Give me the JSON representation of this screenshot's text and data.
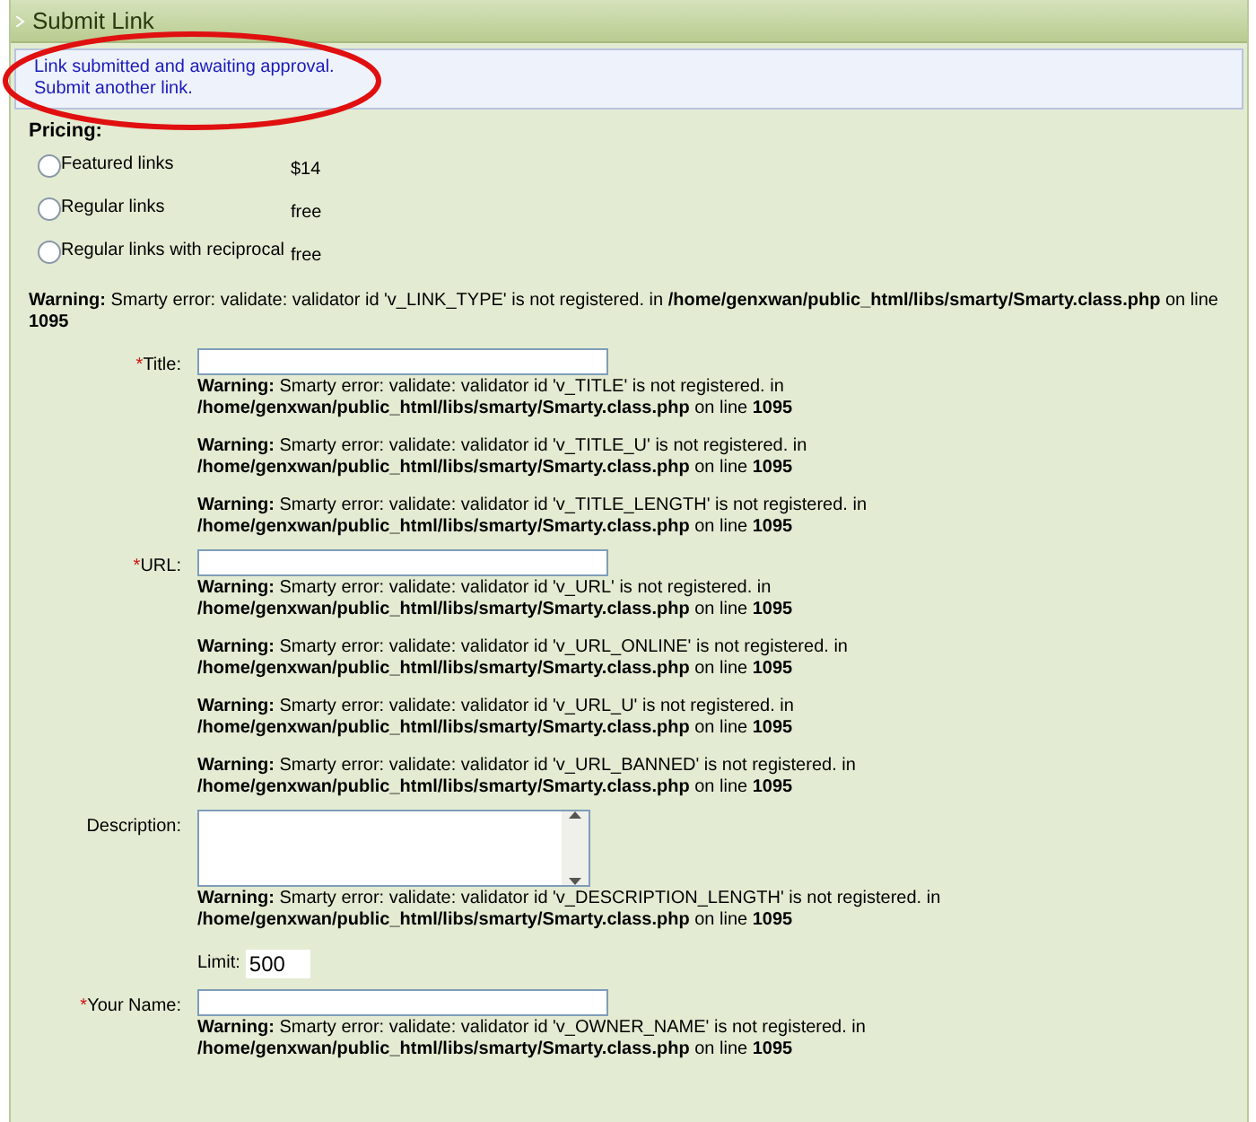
{
  "panel": {
    "title": "Submit Link"
  },
  "message": {
    "text": "Link submitted and awaiting approval.",
    "link": "Submit another link."
  },
  "pricing": {
    "label": "Pricing:",
    "options": [
      {
        "label": "Featured links",
        "price": "$14",
        "selected": false
      },
      {
        "label": "Regular links",
        "price": "free",
        "selected": false
      },
      {
        "label": "Regular links with reciprocal",
        "price": "free",
        "selected": false
      }
    ],
    "warning": "**Warning:** Smarty error: validate: validator id 'v_LINK_TYPE' is not registered. in **/home/genxwan/public_html/libs/smarty/Smarty.class.php** on line **1095**"
  },
  "fields": [
    {
      "kind": "text",
      "required_mark": "*",
      "label": "Title:",
      "warnings": [
        "**Warning:** Smarty error: validate: validator id 'v_TITLE' is not registered. in **/home/genxwan/public_html/libs/smarty/Smarty.class.php** on line **1095**",
        "**Warning:** Smarty error: validate: validator id 'v_TITLE_U' is not registered. in **/home/genxwan/public_html/libs/smarty/Smarty.class.php** on line **1095**",
        "**Warning:** Smarty error: validate: validator id 'v_TITLE_LENGTH' is not registered. in **/home/genxwan/public_html/libs/smarty/Smarty.class.php** on line **1095**"
      ]
    },
    {
      "kind": "text",
      "required_mark": "*",
      "label": "URL:",
      "warnings": [
        "**Warning:** Smarty error: validate: validator id 'v_URL' is not registered. in **/home/genxwan/public_html/libs/smarty/Smarty.class.php** on line **1095**",
        "**Warning:** Smarty error: validate: validator id 'v_URL_ONLINE' is not registered. in **/home/genxwan/public_html/libs/smarty/Smarty.class.php** on line **1095**",
        "**Warning:** Smarty error: validate: validator id 'v_URL_U' is not registered. in **/home/genxwan/public_html/libs/smarty/Smarty.class.php** on line **1095**",
        "**Warning:** Smarty error: validate: validator id 'v_URL_BANNED' is not registered. in **/home/genxwan/public_html/libs/smarty/Smarty.class.php** on line **1095**"
      ]
    },
    {
      "kind": "textarea",
      "label": "Description:",
      "warnings": [
        "**Warning:** Smarty error: validate: validator id 'v_DESCRIPTION_LENGTH' is not registered. in **/home/genxwan/public_html/libs/smarty/Smarty.class.php** on line **1095**"
      ],
      "limit_label": "Limit:",
      "limit_value": "500"
    },
    {
      "kind": "text",
      "required_mark": "*",
      "label": "Your Name:",
      "warnings": [
        "**Warning:** Smarty error: validate: validator id 'v_OWNER_NAME' is not registered. in **/home/genxwan/public_html/libs/smarty/Smarty.class.php** on line **1095**"
      ]
    }
  ]
}
